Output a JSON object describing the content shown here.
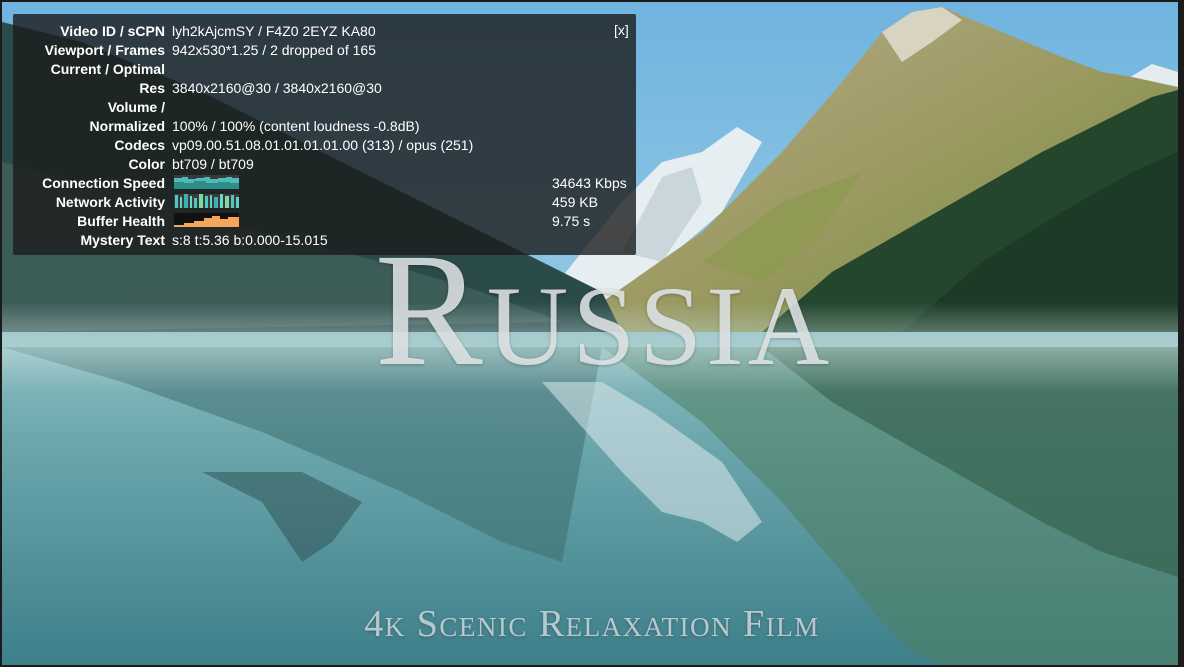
{
  "video": {
    "title": "Russia",
    "subtitle": "4k Scenic Relaxation Film"
  },
  "stats": {
    "close_label": "[x]",
    "rows": [
      {
        "label": "Video ID / sCPN",
        "value": "lyh2kAjcmSY / F4Z0 2EYZ KA80"
      },
      {
        "label": "Viewport / Frames",
        "value": "942x530*1.25 / 2 dropped of 165"
      },
      {
        "label": "Current / Optimal",
        "value": ""
      },
      {
        "label": "Res",
        "value": "3840x2160@30 / 3840x2160@30"
      },
      {
        "label": "Volume /",
        "value": ""
      },
      {
        "label": "Normalized",
        "value": "100% / 100% (content loudness -0.8dB)"
      },
      {
        "label": "Codecs",
        "value": "vp09.00.51.08.01.01.01.01.00 (313) / opus (251)"
      },
      {
        "label": "Color",
        "value": "bt709 / bt709"
      },
      {
        "label": "Connection Speed",
        "value": "34643 Kbps"
      },
      {
        "label": "Network Activity",
        "value": "459 KB"
      },
      {
        "label": "Buffer Health",
        "value": "9.75 s"
      },
      {
        "label": "Mystery Text",
        "value": "s:8 t:5.36 b:0.000-15.015"
      }
    ]
  },
  "colors": {
    "connection_speed": "#3fa5a0",
    "network_activity": "#4fc6c0",
    "buffer_health": "#f5a65b"
  }
}
